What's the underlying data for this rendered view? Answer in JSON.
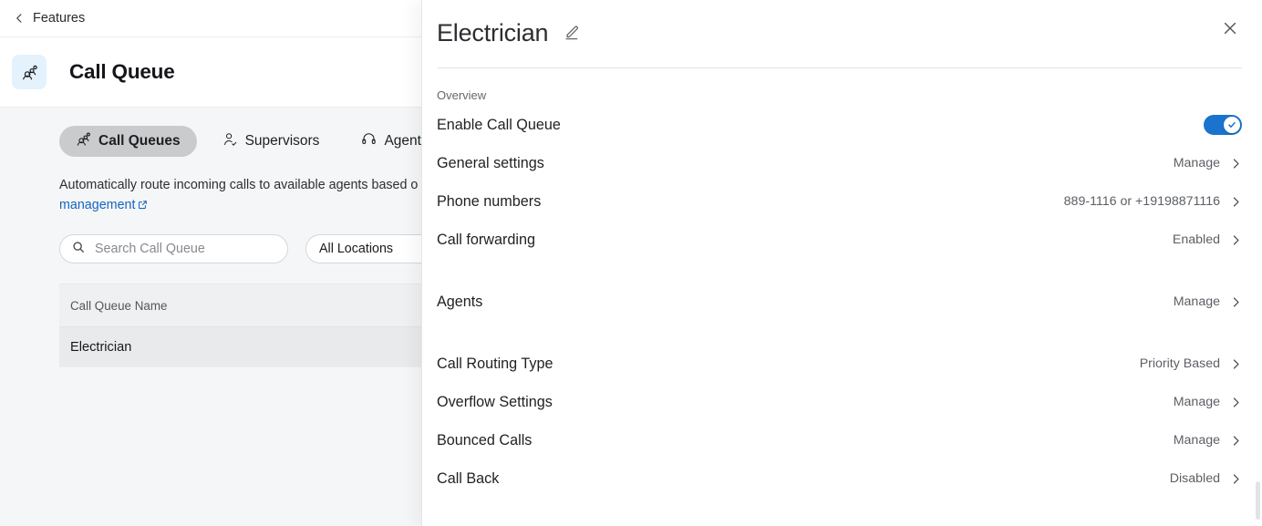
{
  "breadcrumb": {
    "back_label": "Features",
    "back_icon": "chevron-left-icon"
  },
  "header": {
    "title": "Call Queue",
    "icon": "call-queue-group-icon",
    "icon_bg": "#e3f2fd"
  },
  "tabs": [
    {
      "label": "Call Queues",
      "icon": "group-icon",
      "active": true
    },
    {
      "label": "Supervisors",
      "icon": "person-check-icon",
      "active": false
    },
    {
      "label": "Agents",
      "icon": "headset-icon",
      "active": false
    }
  ],
  "description": {
    "text": "Automatically route incoming calls to available agents based o",
    "link_text": "management",
    "link_icon": "external-link-icon"
  },
  "filters": {
    "search": {
      "placeholder": "Search Call Queue",
      "value": "",
      "icon": "search-icon"
    },
    "location_select": {
      "value": "All Locations"
    }
  },
  "table": {
    "columns": [
      "Call Queue Name"
    ],
    "rows": [
      {
        "name": "Electrician",
        "selected": true
      }
    ]
  },
  "panel": {
    "title": "Electrician",
    "edit_icon": "pencil-edit-icon",
    "close_icon": "close-x-icon",
    "section_label": "Overview",
    "toggle_row": {
      "label": "Enable Call Queue",
      "enabled": true,
      "toggle_color": "#1a73cd",
      "knob_icon": "check-icon"
    },
    "rows_group_one": [
      {
        "label": "General settings",
        "value": "Manage",
        "chevron": "chevron-right-icon"
      },
      {
        "label": "Phone numbers",
        "value": "889-1116 or +19198871116",
        "chevron": "chevron-right-icon"
      },
      {
        "label": "Call forwarding",
        "value": "Enabled",
        "chevron": "chevron-right-icon"
      }
    ],
    "rows_group_two": [
      {
        "label": "Agents",
        "value": "Manage",
        "chevron": "chevron-right-icon"
      }
    ],
    "rows_group_three": [
      {
        "label": "Call Routing Type",
        "value": "Priority Based",
        "chevron": "chevron-right-icon"
      },
      {
        "label": "Overflow Settings",
        "value": "Manage",
        "chevron": "chevron-right-icon"
      },
      {
        "label": "Bounced Calls",
        "value": "Manage",
        "chevron": "chevron-right-icon"
      },
      {
        "label": "Call Back",
        "value": "Disabled",
        "chevron": "chevron-right-icon"
      }
    ]
  },
  "colors": {
    "accent_blue": "#1a73cd",
    "link_blue": "#1565c0",
    "icon_badge_bg": "#e3f2fd",
    "content_bg": "#f5f6f7",
    "selected_row_bg": "#e9eaec",
    "tab_active_bg": "#c9cbcd"
  }
}
